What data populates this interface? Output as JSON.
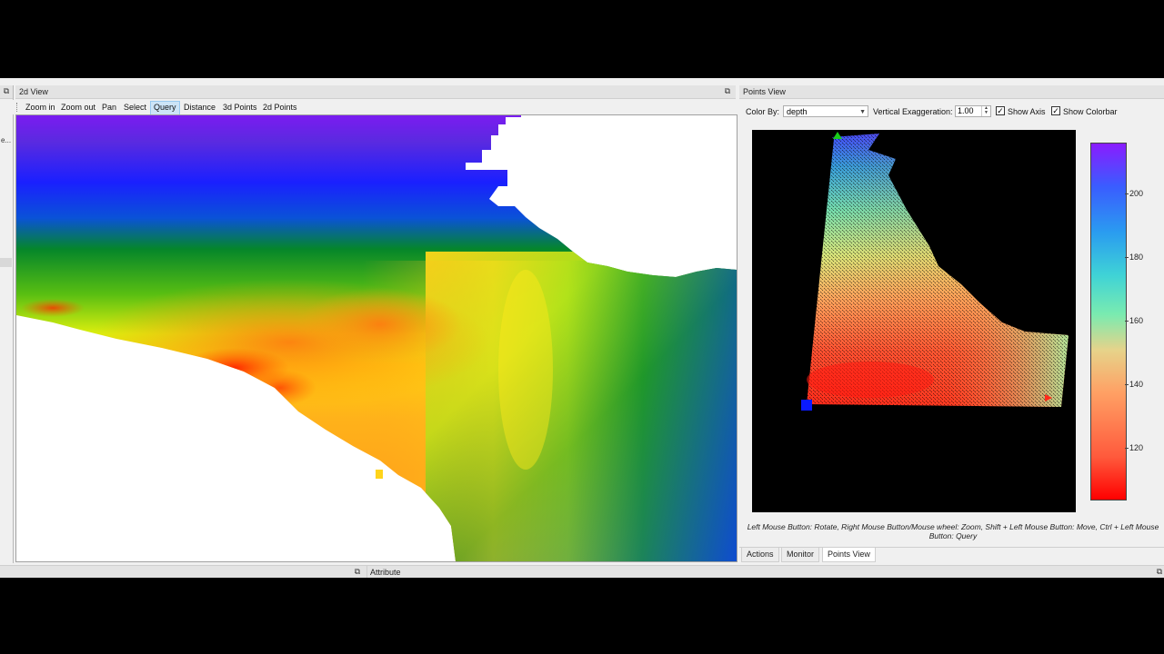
{
  "left_dock": {
    "title": "2d View"
  },
  "toolbar": {
    "buttons": [
      "Zoom in",
      "Zoom out",
      "Pan",
      "Select",
      "Query",
      "Distance",
      "3d Points",
      "2d Points"
    ],
    "active": "Query"
  },
  "points_view": {
    "title": "Points View",
    "color_by_label": "Color By:",
    "color_by_value": "depth",
    "vert_exag_label": "Vertical Exaggeration:",
    "vert_exag_value": "1.00",
    "show_axis_label": "Show Axis",
    "show_axis_checked": true,
    "show_colorbar_label": "Show Colorbar",
    "show_colorbar_checked": true,
    "colorbar_ticks": [
      "200",
      "180",
      "160",
      "140",
      "120"
    ],
    "colorbar_values": [
      200,
      180,
      160,
      140,
      120
    ],
    "colorbar_range": [
      104,
      216
    ],
    "hint_line1": "Left Mouse Button: Rotate,  Right Mouse Button/Mouse wheel: Zoom,  Shift + Left Mouse Button: Move, Ctrl + Left Mouse",
    "hint_line2": "Button: Query"
  },
  "tabs": [
    "Actions",
    "Monitor",
    "Points View"
  ],
  "active_tab": "Points View",
  "bottom": {
    "attribute_title": "Attribute"
  },
  "colors": {
    "colormap": [
      "#ff0000",
      "#ff7a1e",
      "#ffb23c",
      "#e8f060",
      "#7aebb0",
      "#2ec6e6",
      "#2b7fff",
      "#5a3cff",
      "#8a1cff"
    ]
  }
}
